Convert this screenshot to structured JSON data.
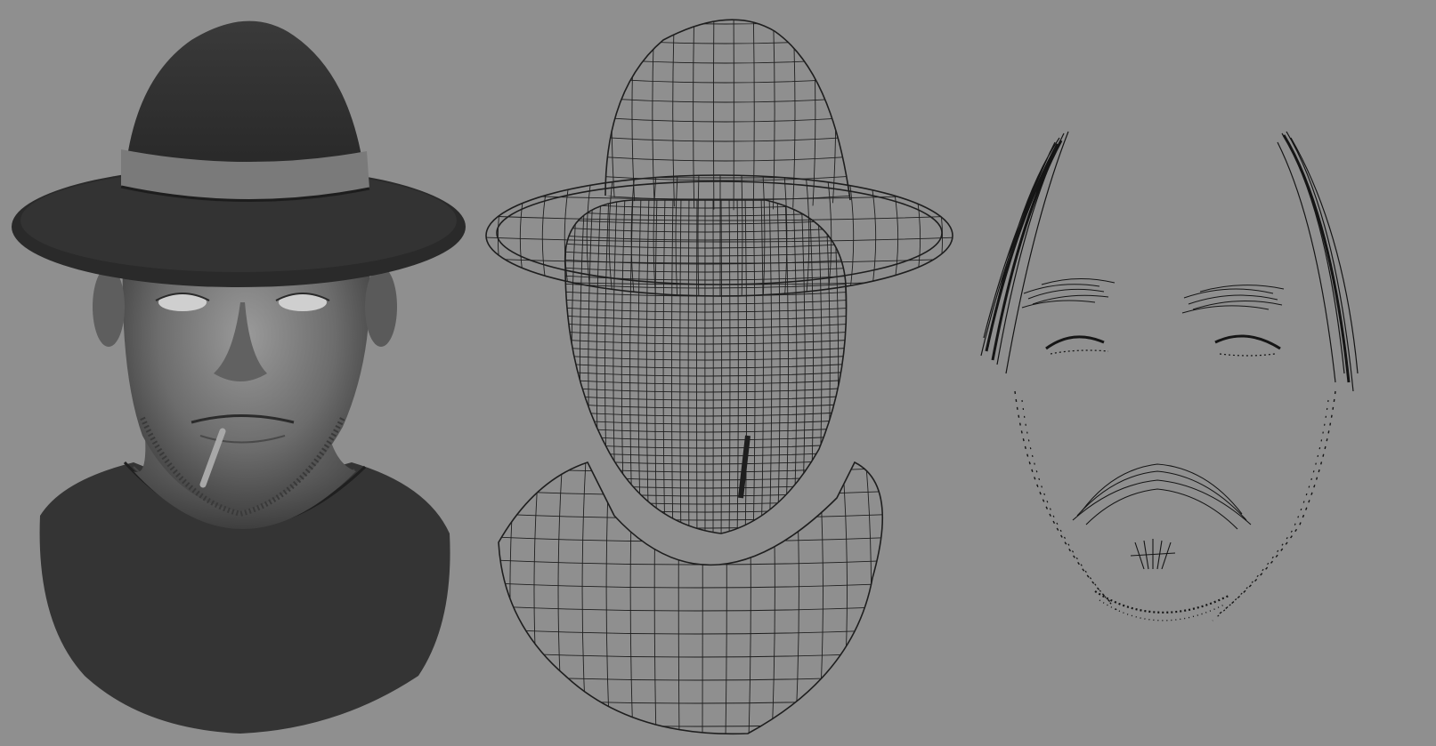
{
  "scene": {
    "background_color": "#8f8f8f",
    "views": [
      {
        "name": "shaded",
        "icon": "shaded-head-render",
        "colors": {
          "skin": "#6d6d6d",
          "shadow": "#3b3b3b",
          "hat": "#2f2f2f",
          "band": "#7a7a7a",
          "shirt": "#333333"
        }
      },
      {
        "name": "wireframe",
        "icon": "wireframe-mesh",
        "colors": {
          "line": "#1e1e1e"
        }
      },
      {
        "name": "hair-curves",
        "icon": "hair-curves-only",
        "colors": {
          "line": "#151515"
        }
      }
    ]
  }
}
